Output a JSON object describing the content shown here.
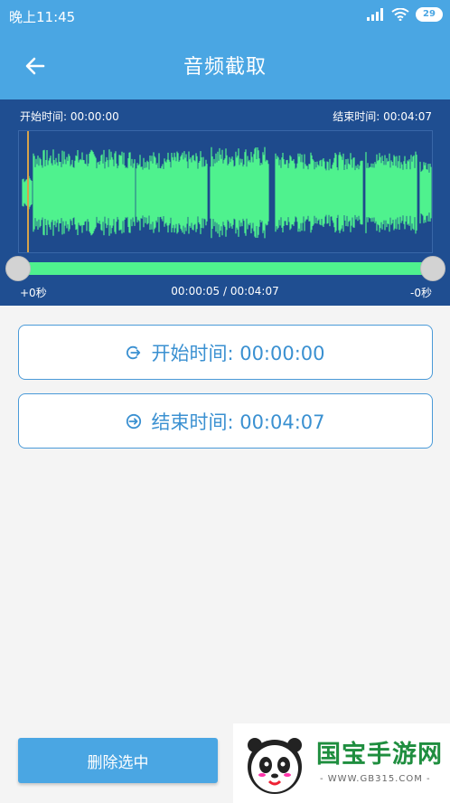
{
  "status_bar": {
    "time": "晚上11:45",
    "battery": "29"
  },
  "app_bar": {
    "title": "音频截取",
    "back_icon": "arrow-left-icon"
  },
  "waveform": {
    "start_label": "开始时间: 00:00:00",
    "end_label": "结束时间: 00:04:07",
    "left_offset": "+0秒",
    "position": "00:00:05 / 00:04:07",
    "right_offset": "-0秒",
    "colors": {
      "panel": "#1f4e91",
      "wave": "#4ff28e",
      "playhead": "#d6a24a"
    }
  },
  "start_button": {
    "label": "开始时间: 00:00:00",
    "icon": "login-arrow-icon"
  },
  "end_button": {
    "label": "结束时间: 00:04:07",
    "icon": "arrow-right-circle-icon"
  },
  "delete_button": {
    "label": "删除选中"
  },
  "watermark": {
    "text": "国宝手游网",
    "url": "- WWW.GB315.COM -"
  },
  "colors": {
    "primary": "#4aa6e3",
    "accent_text": "#3a90d1"
  }
}
